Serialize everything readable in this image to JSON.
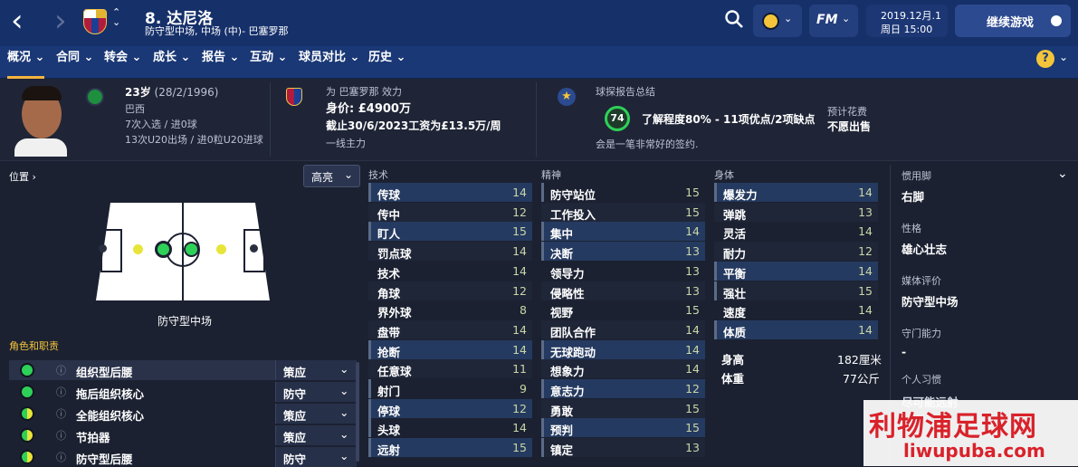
{
  "header": {
    "player_number_name": "8. 达尼洛",
    "subtitle": "防守型中场, 中场 (中)- 巴塞罗那",
    "back_icon": "‹",
    "forward_icon": "›",
    "date": "2019.12月.1",
    "day_time": "周日 15:00",
    "continue_label": "继续游戏",
    "fm_label": "FM"
  },
  "nav": {
    "items": [
      "概况",
      "合同",
      "转会",
      "成长",
      "报告",
      "互动",
      "球员对比",
      "历史"
    ],
    "help": "?"
  },
  "info": {
    "age": "23岁",
    "dob": "(28/2/1996)",
    "nation": "巴西",
    "caps": "7次入选 / 进0球",
    "u20": "13次U20出场 / 进0粒U20进球",
    "club_line": "为 巴塞罗那 效力",
    "value": "身价: £4900万",
    "contract": "截止30/6/2023工资为£13.5万/周",
    "squad_status": "一线主力",
    "scout_title": "球探报告总结",
    "scout_score": "74",
    "knowledge": "了解程度80% - 11项优点/2项缺点",
    "scout_note": "会是一笔非常好的签约.",
    "cost_label": "预计花费",
    "cost_value": "不愿出售"
  },
  "position": {
    "title": "位置 ›",
    "highlight_label": "高亮",
    "position_name": "防守型中场"
  },
  "roles": {
    "title": "角色和职责",
    "items": [
      {
        "name": "组织型后腰",
        "duty": "策应"
      },
      {
        "name": "拖后组织核心",
        "duty": "防守"
      },
      {
        "name": "全能组织核心",
        "duty": "策应"
      },
      {
        "name": "节拍器",
        "duty": "策应"
      },
      {
        "name": "防守型后腰",
        "duty": "防守"
      }
    ]
  },
  "technical": {
    "title": "技术",
    "items": [
      {
        "label": "传球",
        "value": "14"
      },
      {
        "label": "传中",
        "value": "12"
      },
      {
        "label": "盯人",
        "value": "15"
      },
      {
        "label": "罚点球",
        "value": "14"
      },
      {
        "label": "技术",
        "value": "14"
      },
      {
        "label": "角球",
        "value": "12"
      },
      {
        "label": "界外球",
        "value": "8"
      },
      {
        "label": "盘带",
        "value": "14"
      },
      {
        "label": "抢断",
        "value": "14"
      },
      {
        "label": "任意球",
        "value": "11"
      },
      {
        "label": "射门",
        "value": "9"
      },
      {
        "label": "停球",
        "value": "12"
      },
      {
        "label": "头球",
        "value": "14"
      },
      {
        "label": "远射",
        "value": "15"
      }
    ]
  },
  "mental": {
    "title": "精神",
    "items": [
      {
        "label": "防守站位",
        "value": "15"
      },
      {
        "label": "工作投入",
        "value": "15"
      },
      {
        "label": "集中",
        "value": "14"
      },
      {
        "label": "决断",
        "value": "13"
      },
      {
        "label": "领导力",
        "value": "13"
      },
      {
        "label": "侵略性",
        "value": "13"
      },
      {
        "label": "视野",
        "value": "15"
      },
      {
        "label": "团队合作",
        "value": "14"
      },
      {
        "label": "无球跑动",
        "value": "14"
      },
      {
        "label": "想象力",
        "value": "14"
      },
      {
        "label": "意志力",
        "value": "12"
      },
      {
        "label": "勇敢",
        "value": "15"
      },
      {
        "label": "预判",
        "value": "15"
      },
      {
        "label": "镇定",
        "value": "13"
      }
    ]
  },
  "physical": {
    "title": "身体",
    "items": [
      {
        "label": "爆发力",
        "value": "14"
      },
      {
        "label": "弹跳",
        "value": "13"
      },
      {
        "label": "灵活",
        "value": "14"
      },
      {
        "label": "耐力",
        "value": "12"
      },
      {
        "label": "平衡",
        "value": "14"
      },
      {
        "label": "强壮",
        "value": "15"
      },
      {
        "label": "速度",
        "value": "14"
      },
      {
        "label": "体质",
        "value": "14"
      }
    ],
    "height_label": "身高",
    "height_value": "182厘米",
    "weight_label": "体重",
    "weight_value": "77公斤"
  },
  "side": {
    "foot_label": "惯用脚",
    "foot_value": "右脚",
    "personality_label": "性格",
    "personality_value": "雄心壮志",
    "media_label": "媒体评价",
    "media_value": "防守型中场",
    "gk_label": "守门能力",
    "gk_value": "-",
    "habits_label": "个人习惯",
    "habits_value": "尽可能远射"
  },
  "watermark": {
    "cn": "利物浦足球网",
    "en": "liwupuba.com"
  },
  "colors": {
    "accent": "#f4b53f",
    "top": "#16306a",
    "nav": "#1a3876",
    "green": "#2ed158",
    "yellow": "#e8e53a"
  }
}
